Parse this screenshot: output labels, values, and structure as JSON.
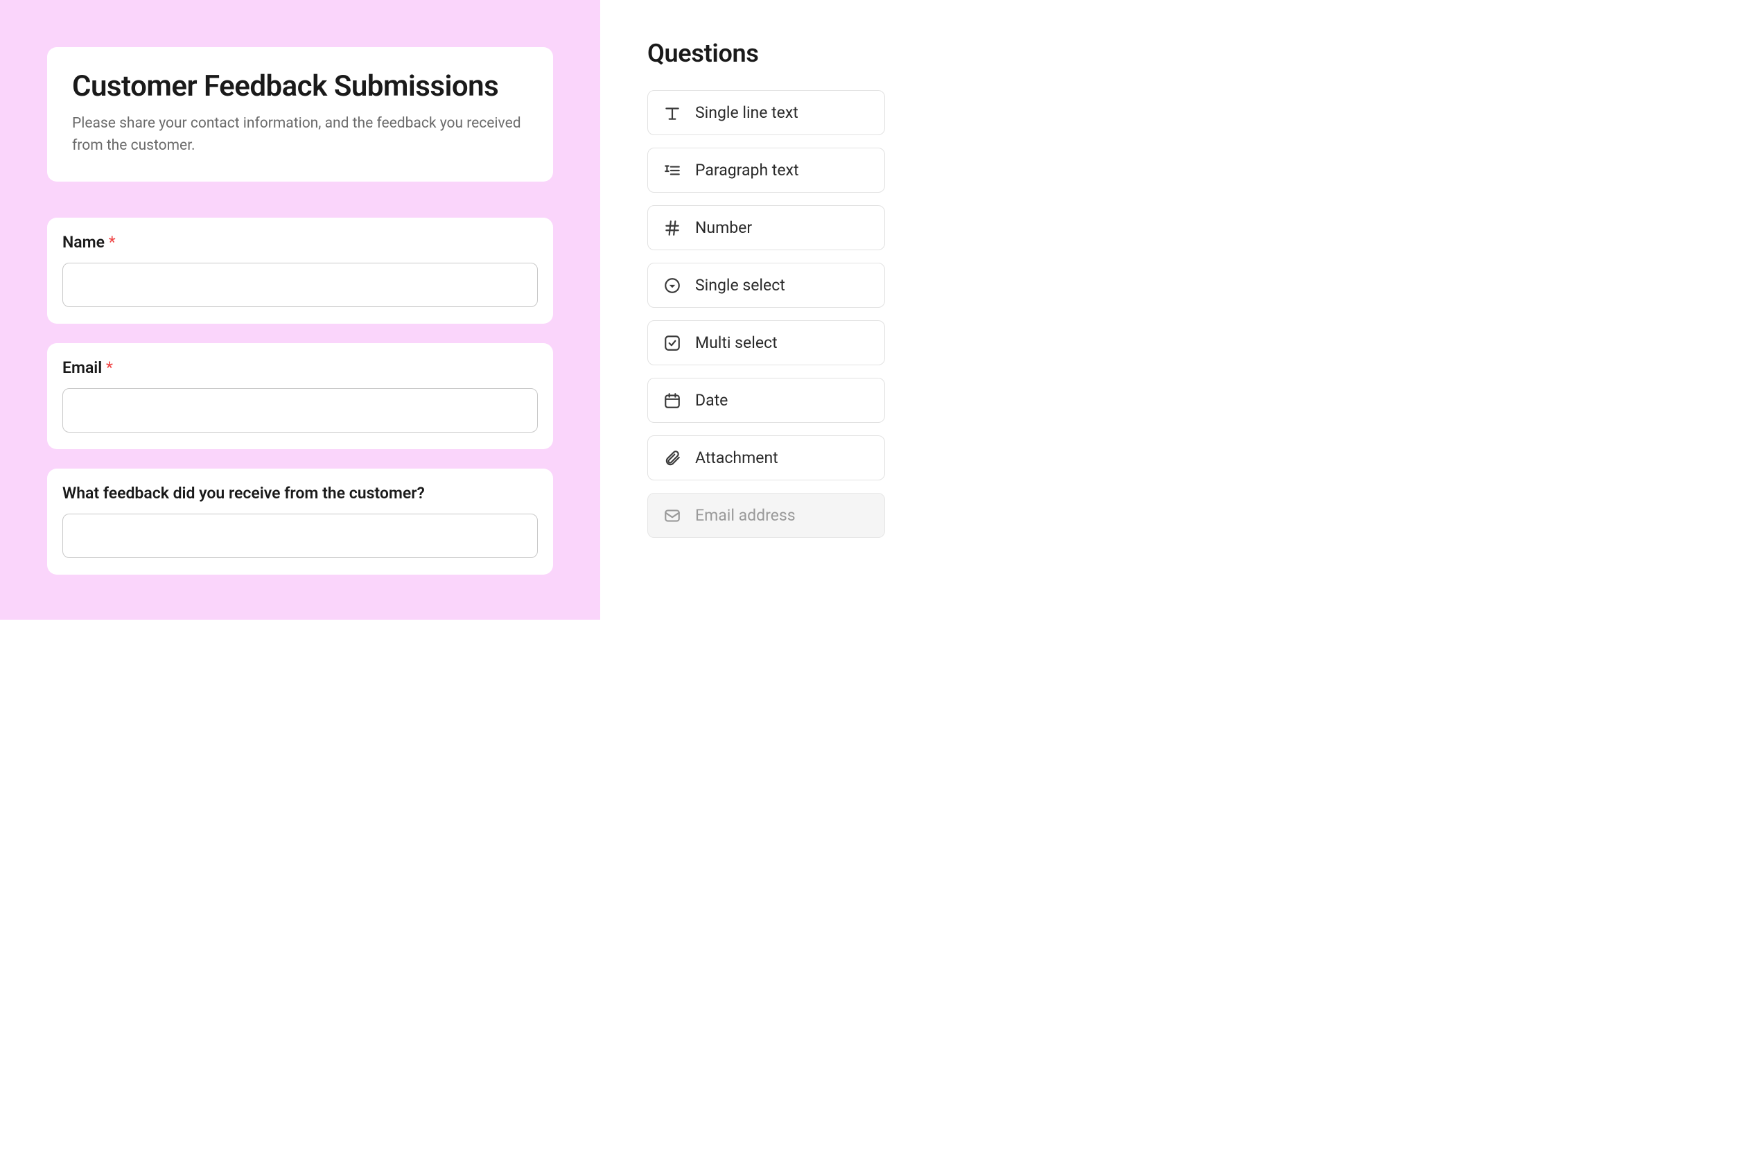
{
  "form": {
    "title": "Customer Feedback Submissions",
    "description": "Please share your contact information, and the feedback you received from the customer.",
    "fields": [
      {
        "label": "Name",
        "required": true
      },
      {
        "label": "Email",
        "required": true
      },
      {
        "label": "What feedback did you receive from the customer?",
        "required": false
      }
    ]
  },
  "sidebar": {
    "title": "Questions",
    "types": [
      {
        "label": "Single line text",
        "icon": "text-icon"
      },
      {
        "label": "Paragraph text",
        "icon": "paragraph-icon"
      },
      {
        "label": "Number",
        "icon": "hash-icon"
      },
      {
        "label": "Single select",
        "icon": "single-select-icon"
      },
      {
        "label": "Multi select",
        "icon": "multi-select-icon"
      },
      {
        "label": "Date",
        "icon": "calendar-icon"
      },
      {
        "label": "Attachment",
        "icon": "attachment-icon"
      },
      {
        "label": "Email address",
        "icon": "email-icon",
        "disabled": true
      }
    ]
  },
  "required_marker": "*"
}
